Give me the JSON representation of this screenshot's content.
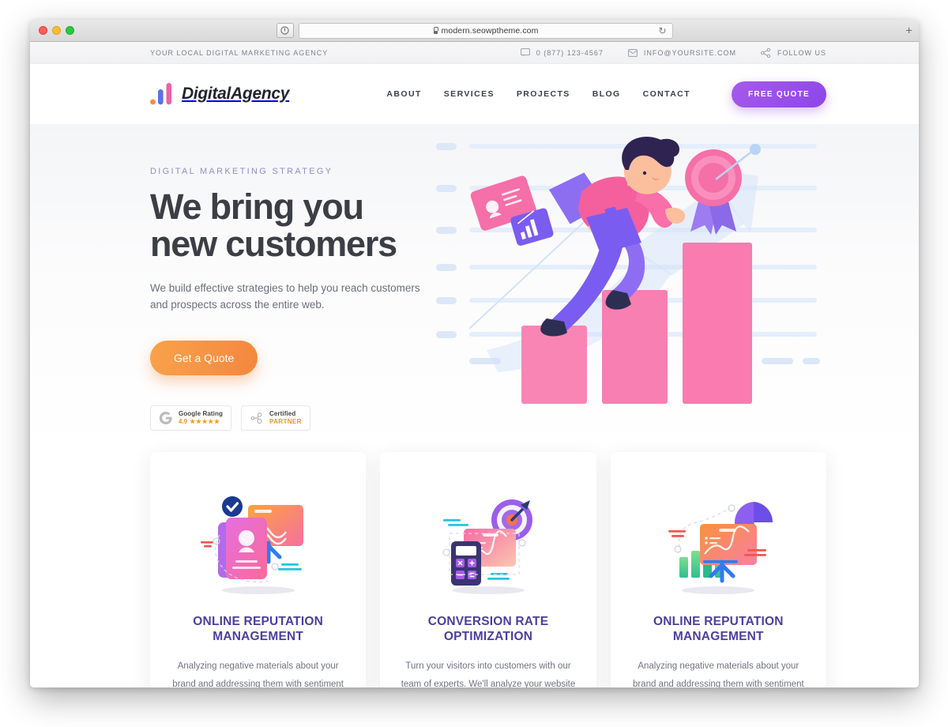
{
  "browser": {
    "url": "modern.seowptheme.com",
    "shield_icon": "shield-icon",
    "reload_icon": "↻",
    "new_tab_icon": "+"
  },
  "topbar": {
    "tagline": "YOUR LOCAL DIGITAL MARKETING AGENCY",
    "items": [
      {
        "icon": "chat-icon",
        "label": "0 (877) 123-4567"
      },
      {
        "icon": "envelope-icon",
        "label": "INFO@YOURSITE.COM"
      },
      {
        "icon": "share-icon",
        "label": "FOLLOW US"
      }
    ]
  },
  "header": {
    "logo_text": "DigitalAgency",
    "nav": [
      {
        "label": "ABOUT"
      },
      {
        "label": "SERVICES"
      },
      {
        "label": "PROJECTS"
      },
      {
        "label": "BLOG"
      },
      {
        "label": "CONTACT"
      }
    ],
    "quote_button": "FREE QUOTE"
  },
  "hero": {
    "eyebrow": "DIGITAL MARKETING STRATEGY",
    "title_line1": "We bring you",
    "title_line2": "new customers",
    "subtitle": "We build effective strategies to help you reach customers and prospects across the entire web.",
    "cta": "Get a Quote",
    "badges": [
      {
        "icon": "google-g-icon",
        "title": "Google Rating",
        "score": "4.9",
        "stars": "★★★★★"
      },
      {
        "icon": "hubspot-icon",
        "title": "Certified",
        "subtitle": "PARTNER"
      }
    ],
    "illustration_name": "running-person-growth-chart-illustration"
  },
  "cards": [
    {
      "illustration_name": "reputation-profile-cards-illustration",
      "title": "ONLINE REPUTATION MANAGEMENT",
      "desc": "Analyzing negative materials about your brand and addressing them with sentiment"
    },
    {
      "illustration_name": "conversion-target-calculator-illustration",
      "title": "CONVERSION RATE OPTIMIZATION",
      "desc": "Turn your visitors into customers with our team of experts. We'll analyze your website"
    },
    {
      "illustration_name": "analytics-piechart-board-illustration",
      "title": "ONLINE REPUTATION MANAGEMENT",
      "desc": "Analyzing negative materials about your brand and addressing them with sentiment"
    }
  ],
  "colors": {
    "accent_purple": "#8e45e8",
    "accent_orange": "#f4873f",
    "title_indigo": "#4b3f9e",
    "eyebrow": "#8d90c9",
    "pink": "#f76ba5",
    "heading": "#3c3e46"
  }
}
